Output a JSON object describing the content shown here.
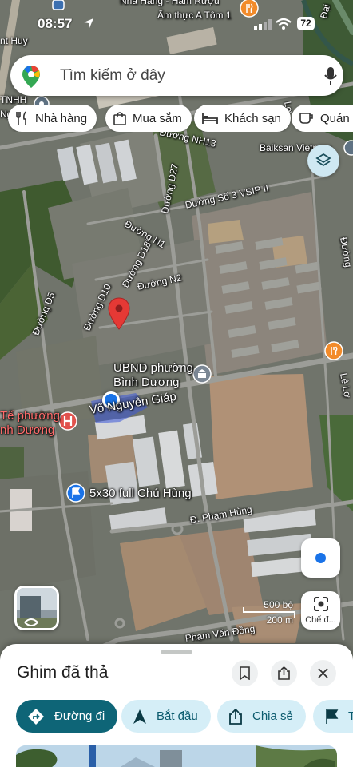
{
  "status_bar": {
    "time": "08:57",
    "battery": "72"
  },
  "search": {
    "placeholder": "Tìm kiếm ở đây"
  },
  "chips": [
    {
      "label": "Nhà hàng",
      "icon": "fork-knife-icon"
    },
    {
      "label": "Mua sắm",
      "icon": "shopping-bag-icon"
    },
    {
      "label": "Khách sạn",
      "icon": "bed-icon"
    },
    {
      "label": "Quán c",
      "icon": "coffee-icon"
    }
  ],
  "map_labels": {
    "nha_hang": "Nhà Hàng - Hàm Rượu",
    "am_thuc": "Ẩm thực A Tôm 1",
    "huy": "nt Huy",
    "tnhh": "TNHH",
    "ng": "Ng",
    "duong_nh13": "Đường NH13",
    "baiksan": "Baiksan Vietnam",
    "duong_d27": "Đường D27",
    "duong_so3": "Đường Số 3 VSIP II",
    "duong_n1": "Đường N1",
    "duong_d18": "Đường D18",
    "duong_n2": "Đường N2",
    "duong_d10": "Đường D10",
    "duong_d5": "Đường D5",
    "ubnd_1": "UBND phường",
    "ubnd_2": "Bình Dương",
    "vo_nguyen_giap": "Võ Nguyên Giáp",
    "te_phuong": "Tế phường",
    "nh_duong": "nh Dương",
    "full_chu_hung": "5x30 full Chú Hùng",
    "pham_hung": "Đ. Phạm Hùng",
    "pham_van_dong": "Phạm Văn Đồng",
    "le_lo": "Lê Lợ",
    "duong_right": "Đường",
    "dai": "Đại",
    "lo": "Lợ"
  },
  "scale": {
    "imperial": "500 bộ",
    "metric": "200 m"
  },
  "mode_button": {
    "label": "Chế đ..."
  },
  "sheet": {
    "title": "Ghim đã thả",
    "actions": [
      {
        "label": "Đường đi",
        "icon": "directions-icon"
      },
      {
        "label": "Bắt đầu",
        "icon": "navigation-arrow-icon"
      },
      {
        "label": "Chia sẻ",
        "icon": "share-icon"
      },
      {
        "label": "T",
        "icon": "flag-icon"
      }
    ]
  },
  "colors": {
    "accent": "#0e6577",
    "chip_tint": "#d5eef7",
    "pin": "#e53935",
    "location_dot": "#1a73e8"
  }
}
